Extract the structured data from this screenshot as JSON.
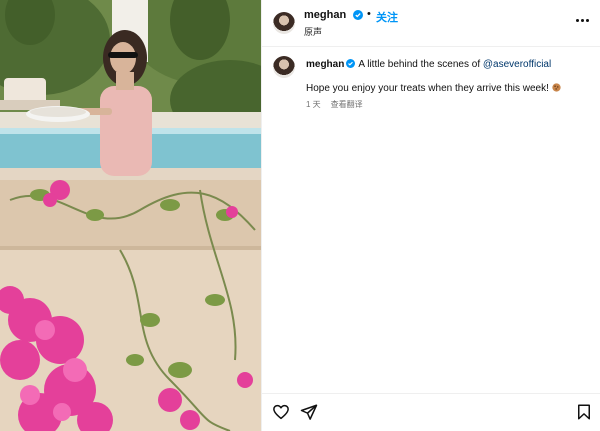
{
  "post": {
    "username": "meghan",
    "follow_label": "关注",
    "separator": "•",
    "audio_label": "原声",
    "caption": {
      "username": "meghan",
      "text_before_mention": "A little behind the scenes of ",
      "mention": "@aseverofficial",
      "line2": "Hope you enjoy your treats when they arrive this week!",
      "emoji_icon": "cookie-icon",
      "time_ago": "1 天",
      "translate_label": "查看翻译"
    }
  },
  "icons": {
    "verified": "verified-badge-icon",
    "more": "more-options-icon",
    "like": "heart-icon",
    "share": "send-icon",
    "save": "bookmark-icon"
  },
  "colors": {
    "verified_blue": "#0095f6",
    "follow_blue": "#0095f6",
    "mention_blue": "#00376b",
    "meta_gray": "#737373"
  }
}
